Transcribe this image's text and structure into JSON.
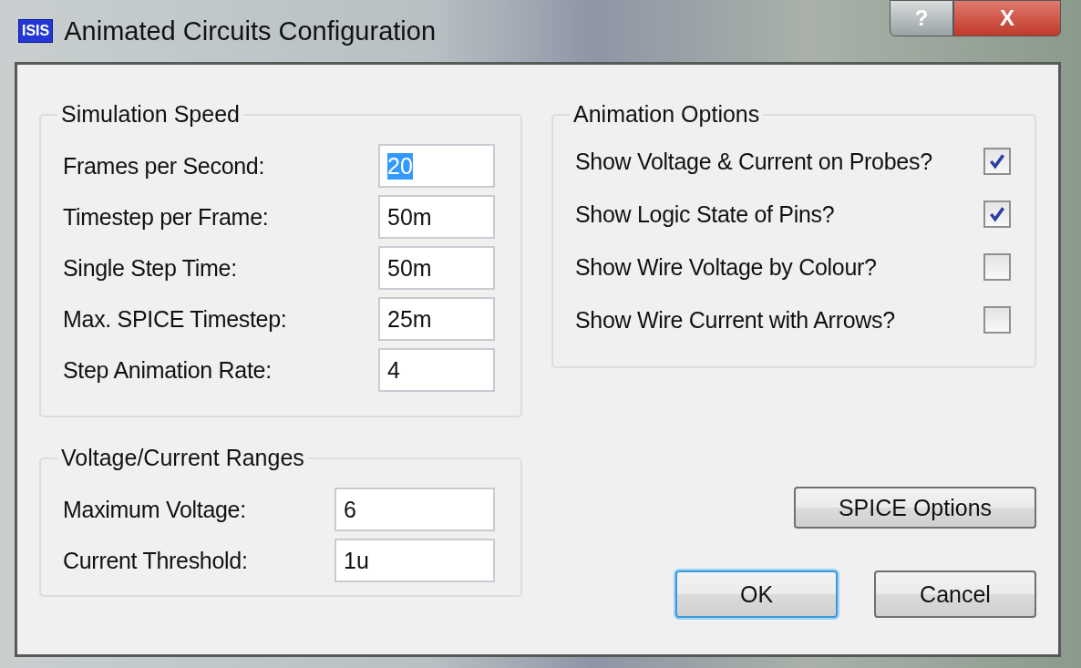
{
  "window": {
    "title": "Animated Circuits Configuration",
    "app_icon_text": "ISIS",
    "help_button": "?",
    "close_button": "X"
  },
  "simulation_speed": {
    "title": "Simulation Speed",
    "fields": [
      {
        "label": "Frames per Second:",
        "value": "20",
        "selected": true
      },
      {
        "label": "Timestep per Frame:",
        "value": "50m",
        "selected": false
      },
      {
        "label": "Single Step Time:",
        "value": "50m",
        "selected": false
      },
      {
        "label": "Max. SPICE Timestep:",
        "value": "25m",
        "selected": false
      },
      {
        "label": "Step Animation Rate:",
        "value": "4",
        "selected": false
      }
    ]
  },
  "voltage_current_ranges": {
    "title": "Voltage/Current Ranges",
    "fields": [
      {
        "label": "Maximum Voltage:",
        "value": "6",
        "selected": false
      },
      {
        "label": "Current Threshold:",
        "value": "1u",
        "selected": false
      }
    ]
  },
  "animation_options": {
    "title": "Animation Options",
    "options": [
      {
        "label": "Show Voltage & Current on Probes?",
        "checked": true
      },
      {
        "label": "Show Logic State of Pins?",
        "checked": true
      },
      {
        "label": "Show Wire Voltage by Colour?",
        "checked": false
      },
      {
        "label": "Show Wire Current with Arrows?",
        "checked": false
      }
    ]
  },
  "buttons": [
    {
      "label": "SPICE Options",
      "kind": "side",
      "default": false
    },
    {
      "label": "OK",
      "kind": "footer",
      "default": true
    },
    {
      "label": "Cancel",
      "kind": "footer",
      "default": false
    }
  ]
}
